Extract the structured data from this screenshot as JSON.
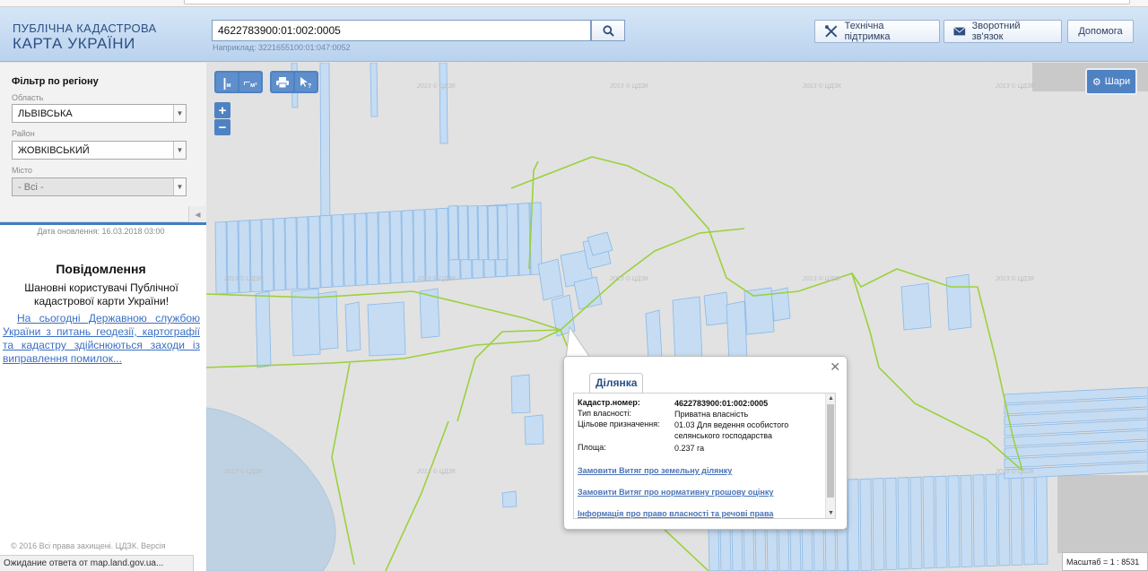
{
  "browser": {
    "status_text": "Ожидание ответа от map.land.gov.ua..."
  },
  "header": {
    "logo_line1": "ПУБЛІЧНА КАДАСТРОВА",
    "logo_line2": "КАРТА УКРАЇНИ",
    "search_value": "4622783900:01:002:0005",
    "search_hint": "Наприклад: 3221655100:01:047:0052",
    "buttons": {
      "support": "Технічна підтримка",
      "feedback": "Зворотний зв'язок",
      "help": "Допомога"
    }
  },
  "sidebar": {
    "filter_title": "Фільтр по регіону",
    "oblast_label": "Область",
    "oblast_value": "ЛЬВІВСЬКА",
    "raion_label": "Район",
    "raion_value": "ЖОВКІВСЬКИЙ",
    "city_label": "Місто",
    "city_value": "- Всі -",
    "update_date": "Дата оновлення: 16.03.2018 03:00",
    "notice_title": "Повідомлення",
    "notice_sub": "Шановні користувачі Публічної кадастрової карти України!",
    "notice_link": "На сьогодні Державною службою України з питань геодезії, картографії та кадастру здійснюються заходи із виправлення помилок...",
    "copyright": "© 2016 Всі права захищені. ЦДЗК. Версія"
  },
  "map": {
    "tools": {
      "ruler": "м",
      "area": "м²"
    },
    "layers_label": "Шари",
    "scale_text": "Масштаб = 1 : 8531",
    "watermark": "2013 © ЦДЗК",
    "colors": {
      "parcel_fill": "#c5dcf3",
      "parcel_stroke": "#8ab8e6",
      "boundary": "#9bd13c",
      "water": "#bfd2e3"
    }
  },
  "popup": {
    "tab": "Ділянка",
    "fields": [
      {
        "label": "Кадастр.номер:",
        "value": "4622783900:01:002:0005"
      },
      {
        "label": "Тип власності:",
        "value": "Приватна власність"
      },
      {
        "label": "Цільове призначення:",
        "value": "01.03 Для ведення особистого селянського господарства"
      },
      {
        "label": "Площа:",
        "value": "0.237 га"
      }
    ],
    "links": [
      "Замовити Витяг про земельну ділянку",
      "Замовити Витяг про нормативну грошову оцінку",
      "Інформація про право власності та речові права"
    ]
  }
}
